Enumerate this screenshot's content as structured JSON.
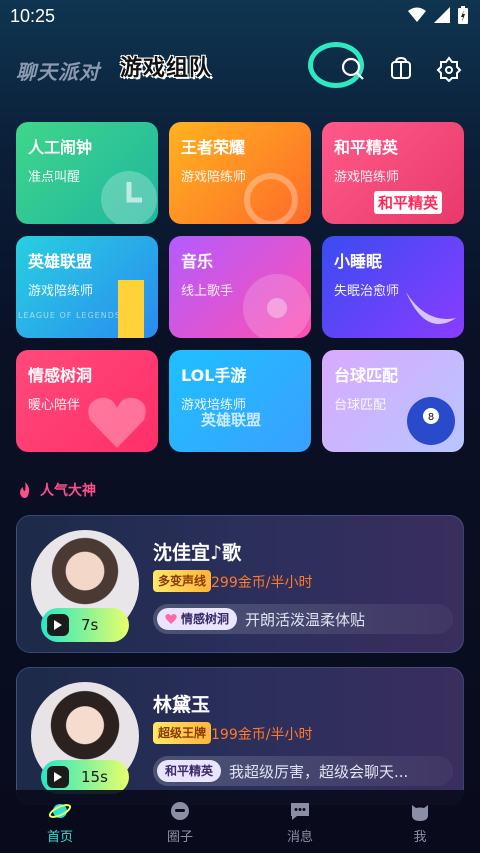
{
  "status_bar": {
    "time": "10:25"
  },
  "header": {
    "tab_chat": "聊天派对",
    "tab_game": "游戏组队",
    "icons": [
      "search-icon",
      "backpack-icon",
      "settings-icon"
    ]
  },
  "cards": [
    {
      "title": "人工闹钟",
      "subtitle": "准点叫醒"
    },
    {
      "title": "王者荣耀",
      "subtitle": "游戏陪练师"
    },
    {
      "title": "和平精英",
      "subtitle": "游戏陪练师",
      "badge": "和平精英"
    },
    {
      "title": "英雄联盟",
      "subtitle": "游戏陪练师",
      "badge": "LEAGUE OF LEGENDS"
    },
    {
      "title": "音乐",
      "subtitle": "线上歌手"
    },
    {
      "title": "小睡眠",
      "subtitle": "失眠治愈师"
    },
    {
      "title": "情感树洞",
      "subtitle": "暖心陪伴"
    },
    {
      "title": "LOL手游",
      "subtitle": "游戏培练师",
      "badge": "英雄联盟"
    },
    {
      "title": "台球匹配",
      "subtitle": "台球匹配"
    }
  ],
  "section": {
    "title": "人气大神"
  },
  "people": [
    {
      "name": "沈佳宜♪歌",
      "tag": "多变声线",
      "price": "299金币/半小时",
      "voice": "7s",
      "bubble_tag": "情感树洞",
      "bubble_msg": "开朗活泼温柔体贴"
    },
    {
      "name": "林黛玉",
      "tag": "超级王牌",
      "price": "199金币/半小时",
      "voice": "15s",
      "bubble_tag": "和平精英",
      "bubble_msg": "我超级厉害，超级会聊天..."
    }
  ],
  "bottom_nav": [
    {
      "label": "首页",
      "active": true
    },
    {
      "label": "圈子",
      "active": false
    },
    {
      "label": "消息",
      "active": false
    },
    {
      "label": "我",
      "active": false
    }
  ]
}
